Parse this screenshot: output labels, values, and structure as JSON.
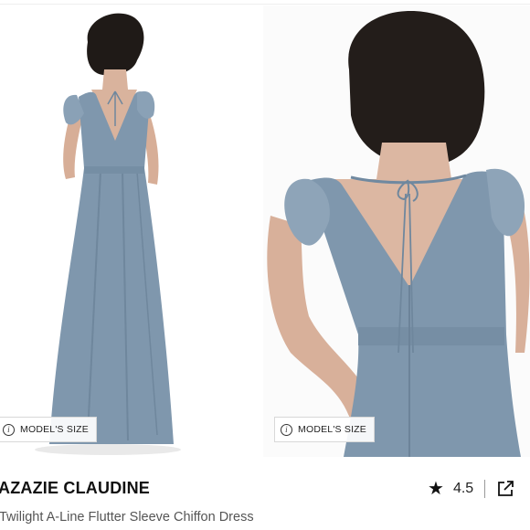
{
  "product": {
    "brand": "AZAZIE CLAUDINE",
    "name": "Twilight A-Line Flutter Sleeve Chiffon Dress",
    "rating": "4.5",
    "icons": {
      "rating": "star-icon",
      "share": "external-link-icon",
      "info": "info-icon"
    }
  },
  "images": [
    {
      "model_size_label": "MODEL'S SIZE",
      "info_glyph": "i"
    },
    {
      "model_size_label": "MODEL'S SIZE",
      "info_glyph": "i"
    }
  ],
  "colors": {
    "dress": "#7f97ad",
    "text": "#111111",
    "subtle": "#555555"
  }
}
